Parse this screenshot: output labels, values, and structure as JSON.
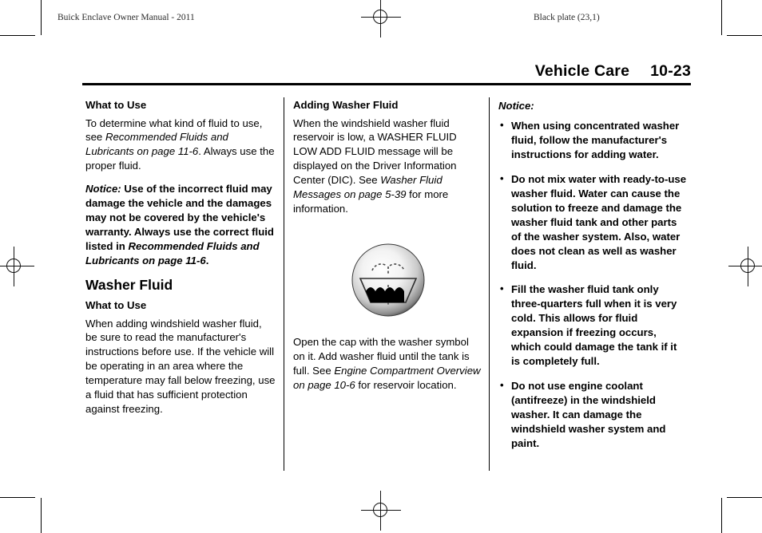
{
  "header": {
    "left": "Buick Enclave Owner Manual - 2011",
    "right": "Black plate (23,1)"
  },
  "title_bar": {
    "section": "Vehicle Care",
    "page_number": "10-23"
  },
  "column1": {
    "heading_what_to_use": "What to Use",
    "paragraph1_part1": "To determine what kind of fluid to use, see ",
    "paragraph1_ref": "Recommended Fluids and Lubricants on page 11-6",
    "paragraph1_part2": ". Always use the proper fluid.",
    "notice_label": "Notice:",
    "notice_part1": " Use of the incorrect fluid may damage the vehicle and the damages may not be covered by the vehicle's warranty. Always use the correct fluid listed in ",
    "notice_ref": "Recommended Fluids and Lubricants on page 11-6",
    "notice_part2": ".",
    "heading_washer_fluid": "Washer Fluid",
    "heading_what_to_use2": "What to Use",
    "paragraph2": "When adding windshield washer fluid, be sure to read the manufacturer's instructions before use. If the vehicle will be operating in an area where the temperature may fall below freezing, use a fluid that has sufficient protection against freezing."
  },
  "column2": {
    "heading_adding_washer_fluid": "Adding Washer Fluid",
    "paragraph1_part1": "When the windshield washer fluid reservoir is low, a WASHER FLUID LOW ADD FLUID message will be displayed on the Driver Information Center (DIC). See ",
    "paragraph1_ref": "Washer Fluid Messages on page 5-39",
    "paragraph1_part2": " for more information.",
    "figure_caption_part1": "Open the cap with the washer symbol on it. Add washer fluid until the tank is full. See ",
    "figure_caption_ref": "Engine Compartment Overview on page 10-6",
    "figure_caption_part2": " for reservoir location.",
    "figure_name": "washer-fluid-cap-symbol"
  },
  "column3": {
    "notice_label": "Notice:",
    "bullets": [
      "When using concentrated washer fluid, follow the manufacturer's instructions for adding water.",
      "Do not mix water with ready-to-use washer fluid. Water can cause the solution to freeze and damage the washer fluid tank and other parts of the washer system. Also, water does not clean as well as washer fluid.",
      "Fill the washer fluid tank only three-quarters full when it is very cold. This allows for fluid expansion if freezing occurs, which could damage the tank if it is completely full.",
      "Do not use engine coolant (antifreeze) in the windshield washer. It can damage the windshield washer system and paint."
    ],
    "bullet_glyph": "•"
  },
  "colors": {
    "text": "#000000",
    "rule": "#000000",
    "head_text": "#2b2b2b"
  }
}
